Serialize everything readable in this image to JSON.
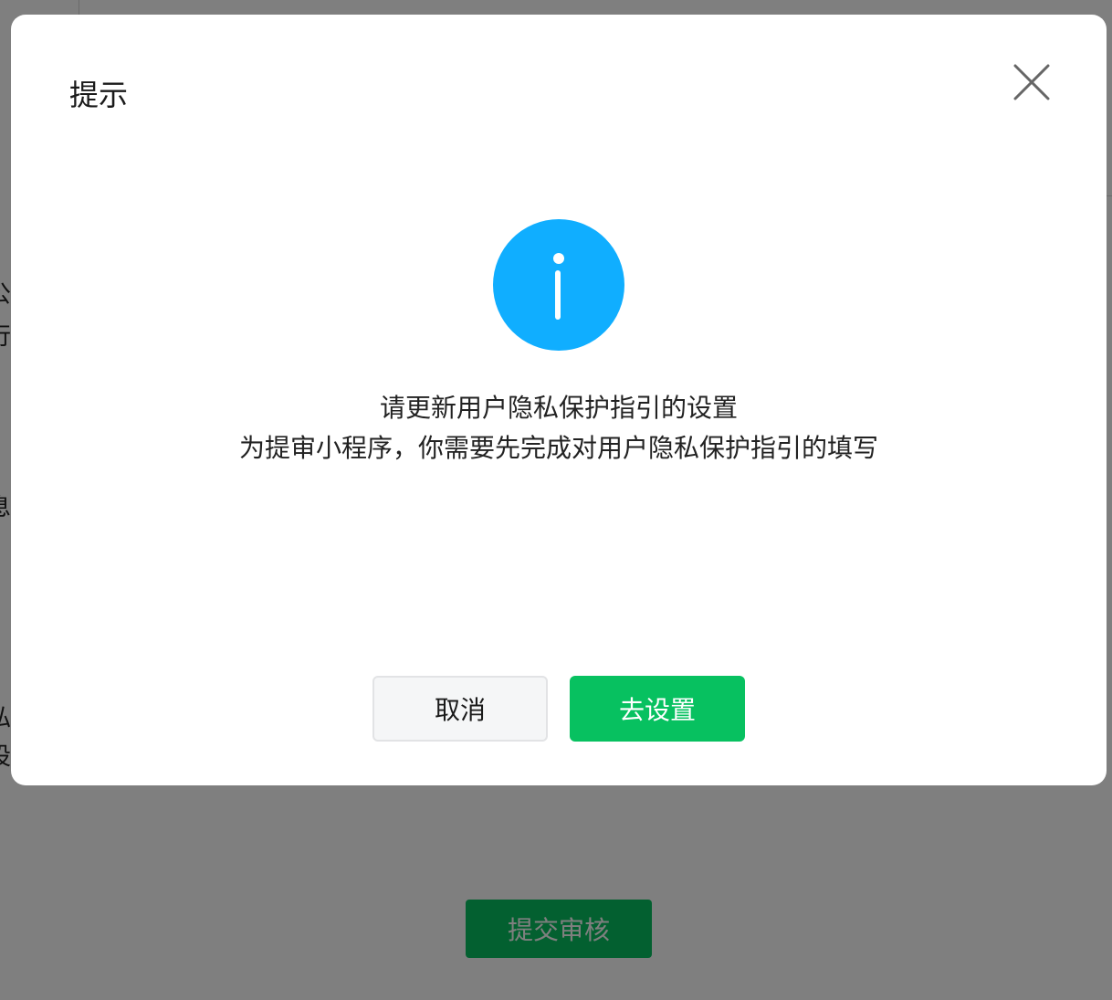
{
  "background": {
    "partial_text": [
      "公",
      "行",
      "息",
      "私",
      "设"
    ],
    "submit_button": "提交审核"
  },
  "dialog": {
    "title": "提示",
    "close_icon": "close-icon",
    "status_icon": "info-icon",
    "message_title": "请更新用户隐私保护指引的设置",
    "message_body": "为提审小程序，你需要先完成对用户隐私保护指引的填写",
    "cancel_label": "取消",
    "confirm_label": "去设置"
  },
  "colors": {
    "primary": "#07c160",
    "info": "#10aeff",
    "mask": "rgba(0,0,0,0.5)"
  }
}
